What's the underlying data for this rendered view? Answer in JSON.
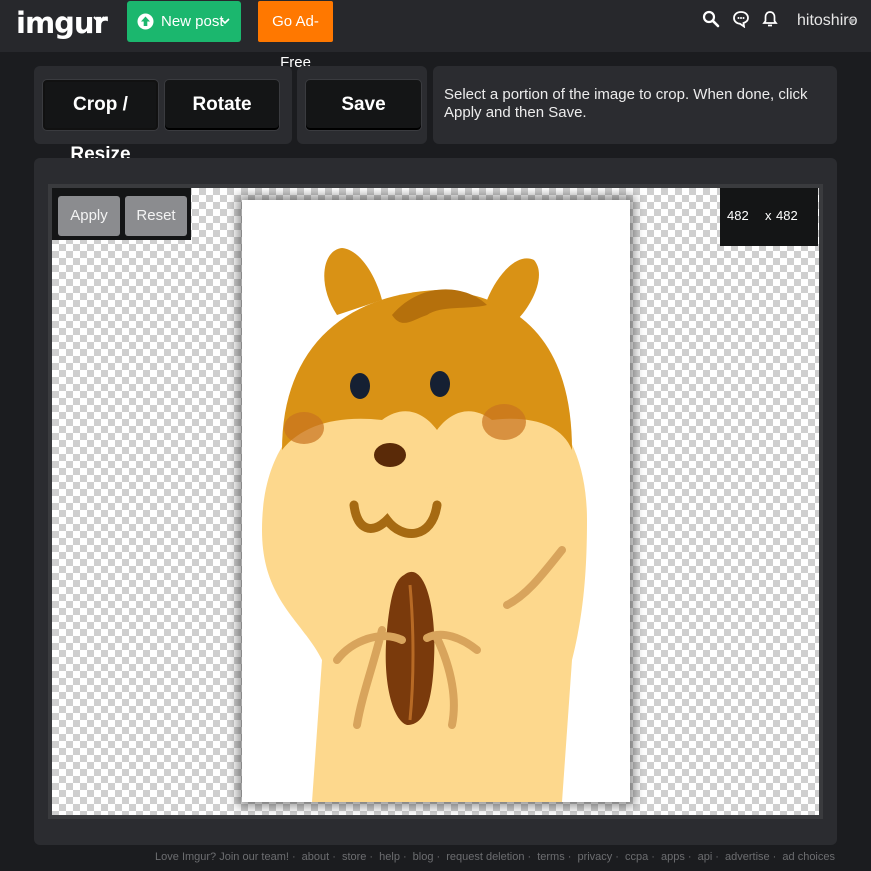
{
  "header": {
    "logo_text": "imgur",
    "new_post_label": "New post",
    "ad_free_label": "Go Ad-Free",
    "username": "hitoshiro",
    "icons": [
      "search-icon",
      "chat-icon",
      "bell-icon"
    ],
    "colors": {
      "new_post": "#1bb76e",
      "ad_free": "#ff7800"
    }
  },
  "toolbar": {
    "crop_label": "Crop / Resize",
    "rotate_label": "Rotate",
    "save_label": "Save",
    "hint": "Select a portion of the image to crop. When done, click Apply and then Save."
  },
  "editor": {
    "apply_label": "Apply",
    "reset_label": "Reset",
    "width": "482",
    "times": "x",
    "height": "482"
  },
  "footer": {
    "links": [
      "Love Imgur? Join our team!",
      "about",
      "store",
      "help",
      "blog",
      "request deletion",
      "terms",
      "privacy",
      "ccpa",
      "apps",
      "api",
      "advertise",
      "ad choices"
    ]
  }
}
